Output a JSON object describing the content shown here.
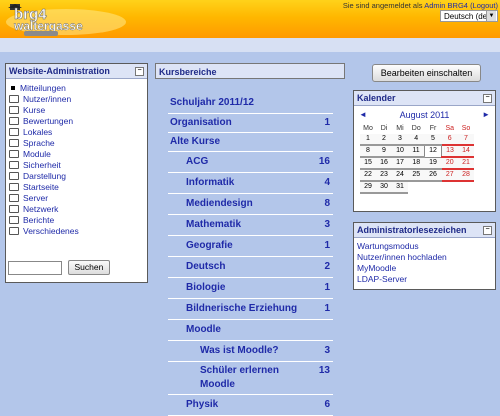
{
  "header": {
    "logo_text": "brg4 waltergasse",
    "logo_tagline": "meine schule",
    "login_prefix": "Sie sind angemeldet als",
    "login_user": "Admin BRG4",
    "login_logout": "(Logout)",
    "language": "Deutsch (de)"
  },
  "admin_block": {
    "title": "Website-Administration",
    "items": [
      "Mitteilungen",
      "Nutzer/innen",
      "Kurse",
      "Bewertungen",
      "Lokales",
      "Sprache",
      "Module",
      "Sicherheit",
      "Darstellung",
      "Startseite",
      "Server",
      "Netzwerk",
      "Berichte",
      "Verschiedenes"
    ],
    "search_button": "Suchen"
  },
  "courses": {
    "title": "Kursbereiche",
    "rows": [
      {
        "label": "Schuljahr 2011/12",
        "count": "",
        "level": 0
      },
      {
        "label": "Organisation",
        "count": "1",
        "level": 0
      },
      {
        "label": "Alte Kurse",
        "count": "",
        "level": 0
      },
      {
        "label": "ACG",
        "count": "16",
        "level": 1
      },
      {
        "label": "Informatik",
        "count": "4",
        "level": 1
      },
      {
        "label": "Mediendesign",
        "count": "8",
        "level": 1
      },
      {
        "label": "Mathematik",
        "count": "3",
        "level": 1
      },
      {
        "label": "Geografie",
        "count": "1",
        "level": 1
      },
      {
        "label": "Deutsch",
        "count": "2",
        "level": 1
      },
      {
        "label": "Biologie",
        "count": "1",
        "level": 1
      },
      {
        "label": "Bildnerische Erziehung",
        "count": "1",
        "level": 1
      },
      {
        "label": "Moodle",
        "count": "",
        "level": 1
      },
      {
        "label": "Was ist Moodle?",
        "count": "3",
        "level": 2
      },
      {
        "label": "Schüler erlernen Moodle",
        "count": "13",
        "level": 2
      },
      {
        "label": "Physik",
        "count": "6",
        "level": 1
      }
    ]
  },
  "edit_button": "Bearbeiten einschalten",
  "calendar": {
    "title": "Kalender",
    "month": "August 2011",
    "prev": "◄",
    "next": "►",
    "weekdays": [
      "Mo",
      "Di",
      "Mi",
      "Do",
      "Fr",
      "Sa",
      "So"
    ],
    "weeks": [
      [
        "1",
        "2",
        "3",
        "4",
        "5",
        "6",
        "7"
      ],
      [
        "8",
        "9",
        "10",
        "11",
        "12",
        "13",
        "14"
      ],
      [
        "15",
        "16",
        "17",
        "18",
        "19",
        "20",
        "21"
      ],
      [
        "22",
        "23",
        "24",
        "25",
        "26",
        "27",
        "28"
      ],
      [
        "29",
        "30",
        "31",
        "",
        "",
        "",
        ""
      ]
    ],
    "today": "12"
  },
  "bookmarks": {
    "title": "Administratorlesezeichen",
    "items": [
      "Wartungsmodus",
      "Nutzer/innen hochladen",
      "MyMoodle",
      "LDAP-Server"
    ]
  },
  "colors": {
    "link": "#1f2aa8",
    "header_orange": "#ff9a00",
    "page_bg": "#b3c6ea",
    "weekend": "#cc2222"
  }
}
